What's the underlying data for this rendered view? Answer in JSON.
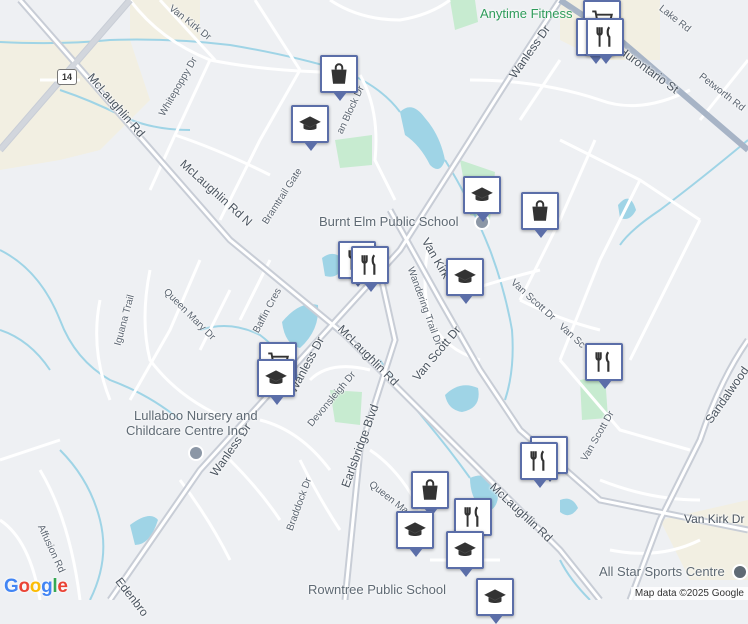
{
  "map": {
    "colors": {
      "background": "#eef0f3",
      "major_road": "#c8cdd6",
      "minor_road": "#ffffff",
      "water": "#9fd4e6",
      "park": "#c7ebd0",
      "industrial": "#f2efe2",
      "highway": "#a7b4c6"
    },
    "street_labels": {
      "van_kirk_dr_top": "Van Kirk Dr",
      "whitepoppy_dr": "Whitepoppy Dr",
      "mclaughlin_rd_top": "McLaughlin Rd",
      "mclaughlin_rd_n": "McLaughlin Rd N",
      "bramtrail_gate": "Bramtrail Gate",
      "ann_block_dr": "an Block Dr",
      "wanless_dr_top": "Wanless Dr",
      "hurontario_st": "Hurontario St",
      "lake_rd": "Lake Rd",
      "petworth_rd": "Petworth Rd",
      "van_kirk_dr_mid": "Van Kirk",
      "wandering_trail_dr": "Wandering Trail Dr",
      "van_scott_dr_mid": "Van Scott Dr",
      "van_scott_dr_right": "Van Scott Dr",
      "van_sc": "Van Sc",
      "van_scott_dr_low": "Van Scott Dr",
      "sandalwood": "Sandalwood",
      "queen_mary_dr": "Queen Mary Dr",
      "iguana_trail": "Iguana Trail",
      "baffin_cres": "Baffin Cres",
      "wanless_dr_mid": "Wanless Dr",
      "mclaughlin_rd_mid": "McLaughlin Rd",
      "devonsleigh_dr": "Devonsleigh Dr",
      "earlsbridge_blvd": "Earlsbridge Blvd",
      "wanless_dr_low": "Wanless Dr",
      "braddock_dr": "Braddock Dr",
      "queen_ma": "Queen Ma",
      "mclaughlin_rd_low": "McLaughlin Rd",
      "van_kirk_dr_low": "Van Kirk Dr",
      "affusion_rd": "Affusion Rd",
      "edenbro": "Edenbro"
    },
    "highway_shield": "14",
    "places": {
      "anytime_fitness": "Anytime Fitness",
      "burnt_elm": "Burnt Elm Public School",
      "lullaboo_1": "Lullaboo Nursery and",
      "lullaboo_2": "Childcare Centre Inc",
      "all_star": "All Star Sports Centre",
      "rowntree": "Rowntree Public School"
    },
    "branding": "Google",
    "attribution": "Map data ©2025 Google"
  }
}
